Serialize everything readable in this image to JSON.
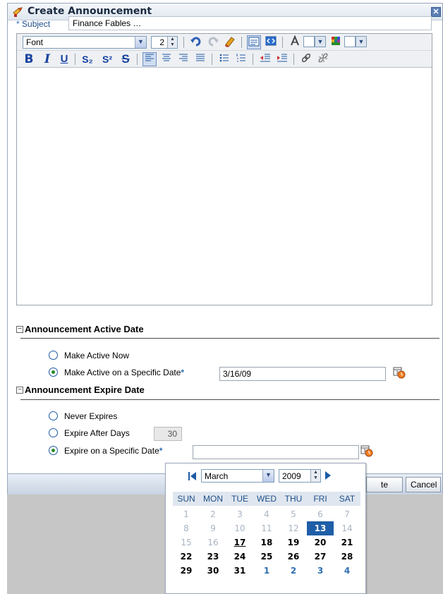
{
  "dialog": {
    "title": "Create Announcement",
    "close_glyph": "✕"
  },
  "subject": {
    "label": "Subject",
    "required_mark": "*",
    "value": "Finance Fables …"
  },
  "toolbar": {
    "font_value": "Font",
    "size_value": "2",
    "icons": [
      "undo-icon",
      "redo-icon",
      "eraser-icon",
      "wysiwyg-mode-icon",
      "source-mode-icon",
      "text-color-icon",
      "background-color-icon"
    ],
    "format_bold": "B",
    "format_italic": "I",
    "format_underline": "U",
    "format_subscript": "S₂",
    "format_superscript": "S²",
    "format_strike": "S"
  },
  "active_section": {
    "title": "Announcement Active Date",
    "toggle": "−",
    "option_now": "Make Active Now",
    "option_specific": "Make Active on a Specific Date",
    "required_mark": "*",
    "date_value": "3/16/09"
  },
  "expire_section": {
    "title": "Announcement Expire Date",
    "toggle": "−",
    "option_never": "Never Expires",
    "option_after": "Expire After Days",
    "days_value": "30",
    "option_specific": "Expire on a Specific Date",
    "required_mark": "*",
    "date_value": ""
  },
  "buttons": {
    "create_partial": "te",
    "cancel": "Cancel"
  },
  "calendar": {
    "month": "March",
    "year": "2009",
    "days_of_week": [
      "SUN",
      "MON",
      "TUE",
      "WED",
      "THU",
      "FRI",
      "SAT"
    ],
    "weeks": [
      [
        {
          "d": "1",
          "s": "past"
        },
        {
          "d": "2",
          "s": "past"
        },
        {
          "d": "3",
          "s": "past"
        },
        {
          "d": "4",
          "s": "past"
        },
        {
          "d": "5",
          "s": "past"
        },
        {
          "d": "6",
          "s": "past"
        },
        {
          "d": "7",
          "s": "past"
        }
      ],
      [
        {
          "d": "8",
          "s": "past"
        },
        {
          "d": "9",
          "s": "past"
        },
        {
          "d": "10",
          "s": "past"
        },
        {
          "d": "11",
          "s": "past"
        },
        {
          "d": "12",
          "s": "past"
        },
        {
          "d": "13",
          "s": "sel"
        },
        {
          "d": "14",
          "s": "past"
        }
      ],
      [
        {
          "d": "15",
          "s": "past"
        },
        {
          "d": "16",
          "s": "past"
        },
        {
          "d": "17",
          "s": "today"
        },
        {
          "d": "18",
          "s": ""
        },
        {
          "d": "19",
          "s": ""
        },
        {
          "d": "20",
          "s": ""
        },
        {
          "d": "21",
          "s": ""
        }
      ],
      [
        {
          "d": "22",
          "s": ""
        },
        {
          "d": "23",
          "s": ""
        },
        {
          "d": "24",
          "s": ""
        },
        {
          "d": "25",
          "s": ""
        },
        {
          "d": "26",
          "s": ""
        },
        {
          "d": "27",
          "s": ""
        },
        {
          "d": "28",
          "s": ""
        }
      ],
      [
        {
          "d": "29",
          "s": ""
        },
        {
          "d": "30",
          "s": ""
        },
        {
          "d": "31",
          "s": ""
        },
        {
          "d": "1",
          "s": "next"
        },
        {
          "d": "2",
          "s": "next"
        },
        {
          "d": "3",
          "s": "next"
        },
        {
          "d": "4",
          "s": "next"
        }
      ]
    ]
  },
  "colors": {
    "selected_day": "#1f5ea8",
    "link_blue": "#2d6fb2",
    "radio_dot": "#2a8a2a"
  }
}
